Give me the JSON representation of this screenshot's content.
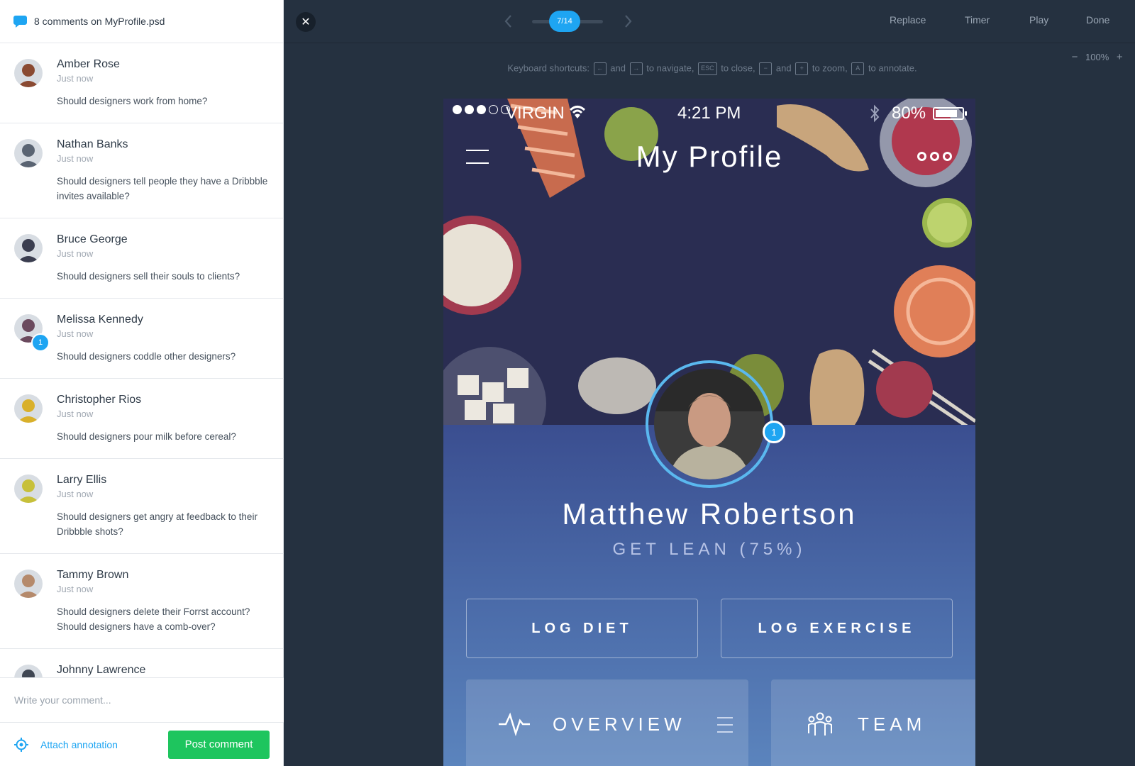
{
  "colors": {
    "accent": "#1ea5f2",
    "post_button": "#1ec55e",
    "workspace_bg": "#253140"
  },
  "panel": {
    "header_title": "8 comments on MyProfile.psd",
    "header_icon": "chat-bubble-icon",
    "comments": [
      {
        "author": "Amber Rose",
        "time": "Just now",
        "text": "Should designers work from home?",
        "avatar_color": "#8a4a32"
      },
      {
        "author": "Nathan Banks",
        "time": "Just now",
        "text": "Should designers tell people they have a Dribbble invites available?",
        "avatar_color": "#5a6472"
      },
      {
        "author": "Bruce George",
        "time": "Just now",
        "text": "Should designers sell their souls to clients?",
        "avatar_color": "#3a3d4f"
      },
      {
        "author": "Melissa Kennedy",
        "time": "Just now",
        "text": "Should designers coddle other designers?",
        "avatar_color": "#6b4a5e",
        "badge": "1"
      },
      {
        "author": "Christopher Rios",
        "time": "Just now",
        "text": "Should designers pour milk before cereal?",
        "avatar_color": "#d9b02a"
      },
      {
        "author": "Larry Ellis",
        "time": "Just now",
        "text": "Should designers get angry at feedback to their Dribbble shots?",
        "avatar_color": "#c7c03a"
      },
      {
        "author": "Tammy Brown",
        "time": "Just now",
        "text": "Should designers delete their Forrst account? Should designers have a comb-over?",
        "avatar_color": "#b58a6c"
      },
      {
        "author": "Johnny Lawrence",
        "time": "",
        "text": "",
        "avatar_color": "#3f4652"
      }
    ],
    "input_placeholder": "Write your comment...",
    "attach_label": "Attach annotation",
    "post_label": "Post comment"
  },
  "topbar": {
    "pager": "7/14",
    "actions": {
      "replace": "Replace",
      "timer": "Timer",
      "play": "Play",
      "done": "Done"
    }
  },
  "zoom": {
    "minus": "−",
    "value": "100%",
    "plus": "+"
  },
  "shortcuts": {
    "prefix": "Keyboard shortcuts:",
    "and": "and",
    "navigate": "to navigate,",
    "close": "to close,",
    "zoom": "to zoom,",
    "annotate": "to annotate.",
    "keys": {
      "left": "←",
      "right": "→",
      "esc": "ESC",
      "minus": "−",
      "plus": "+",
      "a": "A"
    }
  },
  "phone": {
    "carrier": "VIRGIN",
    "signal_bars": 3,
    "time": "4:21 PM",
    "battery": "80%",
    "title": "My Profile",
    "user_name": "Matthew Robertson",
    "goal": "GET LEAN (75%)",
    "profile_badge": "1",
    "log_diet": "LOG DIET",
    "log_exercise": "LOG EXERCISE",
    "card_overview": "OVERVIEW",
    "card_team": "TEAM"
  }
}
